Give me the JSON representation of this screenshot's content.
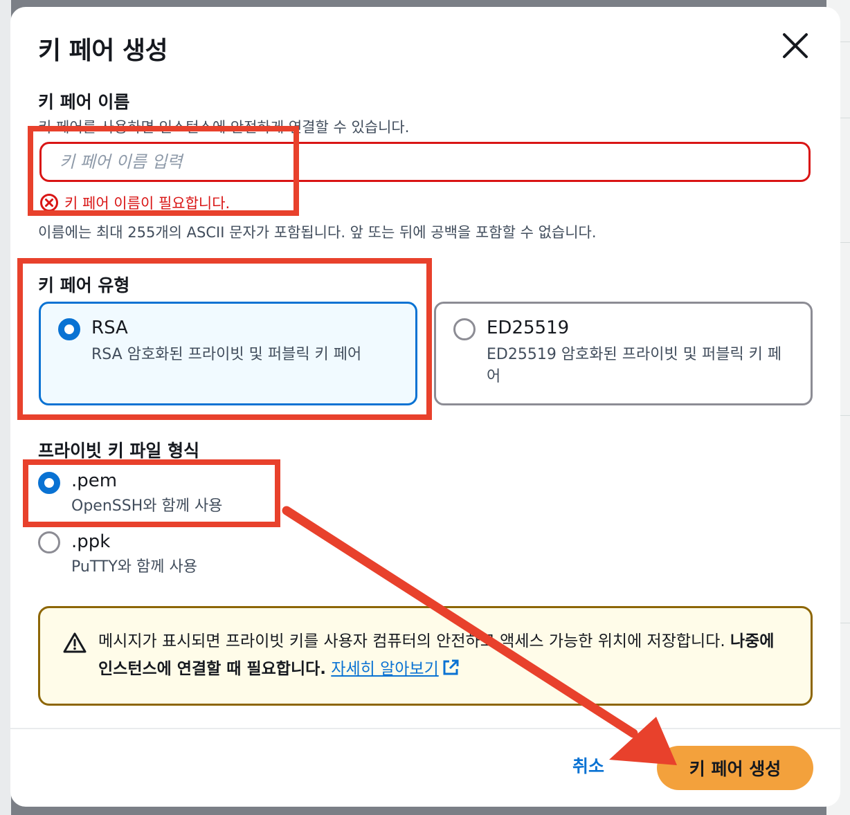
{
  "dialog": {
    "title": "키 페어 생성",
    "close_icon": "close-icon"
  },
  "key_name": {
    "label": "키 페어 이름",
    "description": "키 페어를 사용하면 인스턴스에 안전하게 연결할 수 있습니다.",
    "value": "",
    "placeholder": "키 페어 이름 입력",
    "error": "키 페어 이름이 필요합니다.",
    "constraint": "이름에는 최대 255개의 ASCII 문자가 포함됩니다. 앞 또는 뒤에 공백을 포함할 수 없습니다."
  },
  "key_type": {
    "label": "키 페어 유형",
    "options": [
      {
        "title": "RSA",
        "description": "RSA 암호화된 프라이빗 및 퍼블릭 키 페어",
        "selected": true
      },
      {
        "title": "ED25519",
        "description": "ED25519 암호화된 프라이빗 및 퍼블릭 키 페어",
        "selected": false
      }
    ]
  },
  "file_format": {
    "label": "프라이빗 키 파일 형식",
    "options": [
      {
        "title": ".pem",
        "description": "OpenSSH와 함께 사용",
        "selected": true
      },
      {
        "title": ".ppk",
        "description": "PuTTY와 함께 사용",
        "selected": false
      }
    ]
  },
  "alert": {
    "icon": "warning-icon",
    "text": "메시지가 표시되면 프라이빗 키를 사용자 컴퓨터의 안전하고 액세스 가능한 위치에 저장합니다. ",
    "bold_text": "나중에 인스턴스에 연결할 때 필요합니다.",
    "link": "자세히 알아보기",
    "link_icon": "external-link-icon"
  },
  "footer": {
    "cancel_label": "취소",
    "create_label": "키 페어 생성"
  },
  "colors": {
    "primary": "#0972d3",
    "error": "#d91515",
    "primary_button": "#f3a13c",
    "annotation": "#e8412c",
    "warning_border": "#8d6605"
  }
}
